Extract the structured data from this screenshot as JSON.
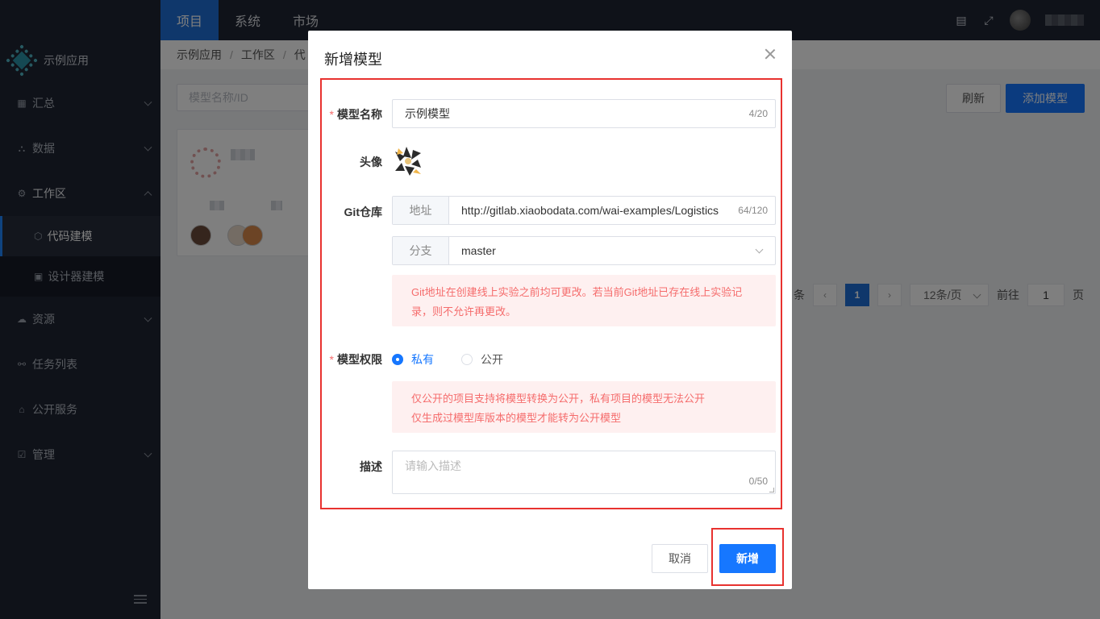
{
  "topnav": {
    "tabs": [
      {
        "label": "项目",
        "active": true
      },
      {
        "label": "系统",
        "active": false
      },
      {
        "label": "市场",
        "active": false
      }
    ],
    "icons": [
      "document-icon",
      "fullscreen-icon"
    ]
  },
  "sidebar": {
    "app_name": "示例应用",
    "items": [
      {
        "label": "汇总",
        "icon": "dashboard-icon"
      },
      {
        "label": "数据",
        "icon": "data-icon"
      },
      {
        "label": "工作区",
        "icon": "workspace-icon",
        "open": true
      },
      {
        "label": "资源",
        "icon": "cloud-icon"
      },
      {
        "label": "任务列表",
        "icon": "task-icon"
      },
      {
        "label": "公开服务",
        "icon": "service-icon"
      },
      {
        "label": "管理",
        "icon": "manage-icon"
      }
    ],
    "sub_items": [
      {
        "label": "代码建模",
        "active": true
      },
      {
        "label": "设计器建模",
        "active": false
      }
    ]
  },
  "breadcrumb": [
    "示例应用",
    "工作区",
    "代"
  ],
  "page": {
    "search_placeholder": "模型名称/ID",
    "refresh_label": "刷新",
    "add_model_label": "添加模型"
  },
  "pagination": {
    "total_suffix": "条",
    "current_page": "1",
    "page_size": "12条/页",
    "goto_label": "前往",
    "goto_value": "1",
    "page_suffix": "页"
  },
  "dialog": {
    "title": "新增模型",
    "name_label": "模型名称",
    "name_value": "示例模型",
    "name_count": "4/20",
    "avatar_label": "头像",
    "git_label": "Git仓库",
    "address_prefix": "地址",
    "address_value": "http://gitlab.xiaobodata.com/wai-examples/Logistics",
    "address_count": "64/120",
    "branch_prefix": "分支",
    "branch_value": "master",
    "git_alert": "Git地址在创建线上实验之前均可更改。若当前Git地址已存在线上实验记录，则不允许再更改。",
    "permission_label": "模型权限",
    "permission_private": "私有",
    "permission_public": "公开",
    "permission_selected": "private",
    "permission_alert_1": "仅公开的项目支持将模型转换为公开，私有项目的模型无法公开",
    "permission_alert_2": "仅生成过模型库版本的模型才能转为公开模型",
    "desc_label": "描述",
    "desc_placeholder": "请输入描述",
    "desc_count": "0/50",
    "cancel_label": "取消",
    "submit_label": "新增",
    "highlight_color": "#e8322f",
    "accent_color": "#1677ff"
  }
}
